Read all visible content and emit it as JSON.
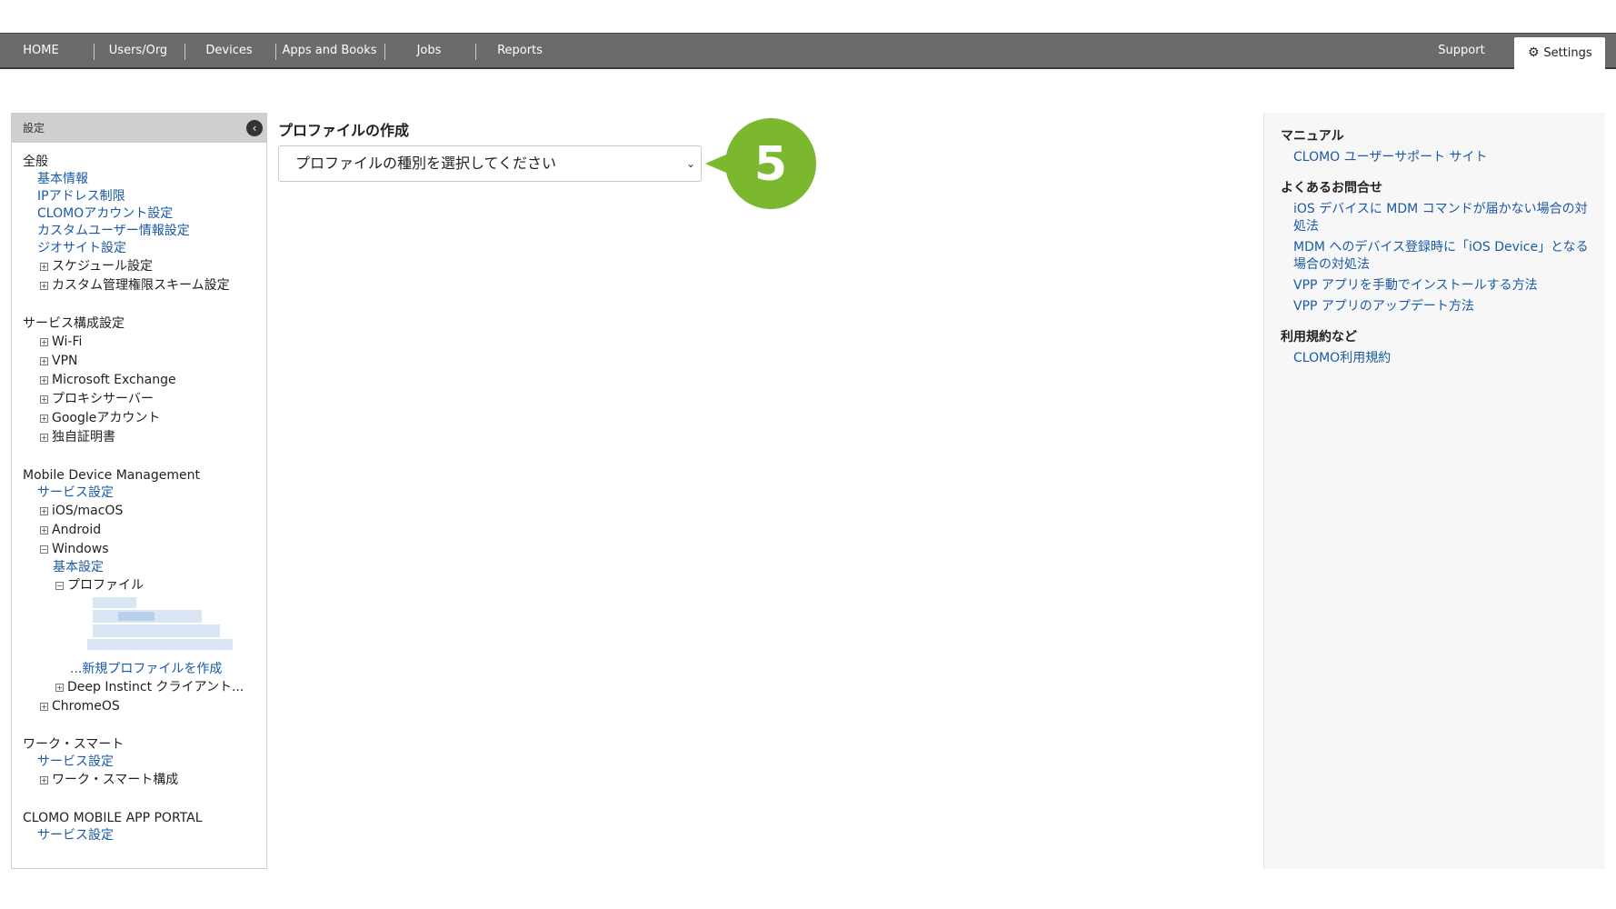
{
  "nav": {
    "items": [
      "HOME",
      "Users/Org",
      "Devices",
      "Apps and Books",
      "Jobs",
      "Reports"
    ],
    "support": "Support",
    "settings": "Settings"
  },
  "sidebar": {
    "header": "設定",
    "general_title": "全般",
    "general_links": [
      "基本情報",
      "IPアドレス制限",
      "CLOMOアカウント設定",
      "カスタムユーザー情報設定",
      "ジオサイト設定"
    ],
    "general_trees": [
      "スケジュール設定",
      "カスタム管理権限スキーム設定"
    ],
    "service_title": "サービス構成設定",
    "service_trees": [
      "Wi-Fi",
      "VPN",
      "Microsoft Exchange",
      "プロキシサーバー",
      "Googleアカウント",
      "独自証明書"
    ],
    "mdm_title": "Mobile Device Management",
    "mdm_service_link": "サービス設定",
    "mdm_trees": [
      "iOS/macOS",
      "Android",
      "Windows"
    ],
    "windows_basic": "基本設定",
    "windows_profile": "プロファイル",
    "new_profile": "...新規プロファイルを作成",
    "deep_instinct": "Deep Instinct クライアント...",
    "chromeos": "ChromeOS",
    "work_title": "ワーク・スマート",
    "work_service_link": "サービス設定",
    "work_tree": "ワーク・スマート構成",
    "portal_title": "CLOMO MOBILE APP PORTAL",
    "portal_service_link": "サービス設定",
    "tree_collapsed": "⊞",
    "tree_expanded": "⊟"
  },
  "main": {
    "title": "プロファイルの作成",
    "select_placeholder": "プロファイルの種別を選択してください",
    "callout_number": "5",
    "callout_color": "#7cb82f"
  },
  "right": {
    "manual_title": "マニュアル",
    "manual_links": [
      "CLOMO ユーザーサポート サイト"
    ],
    "faq_title": "よくあるお問合せ",
    "faq_links": [
      "iOS デバイスに MDM コマンドが届かない場合の対処法",
      "MDM へのデバイス登録時に「iOS Device」となる場合の対処法",
      "VPP アプリを手動でインストールする方法",
      "VPP アプリのアップデート方法"
    ],
    "terms_title": "利用規約など",
    "terms_links": [
      "CLOMO利用規約"
    ]
  }
}
